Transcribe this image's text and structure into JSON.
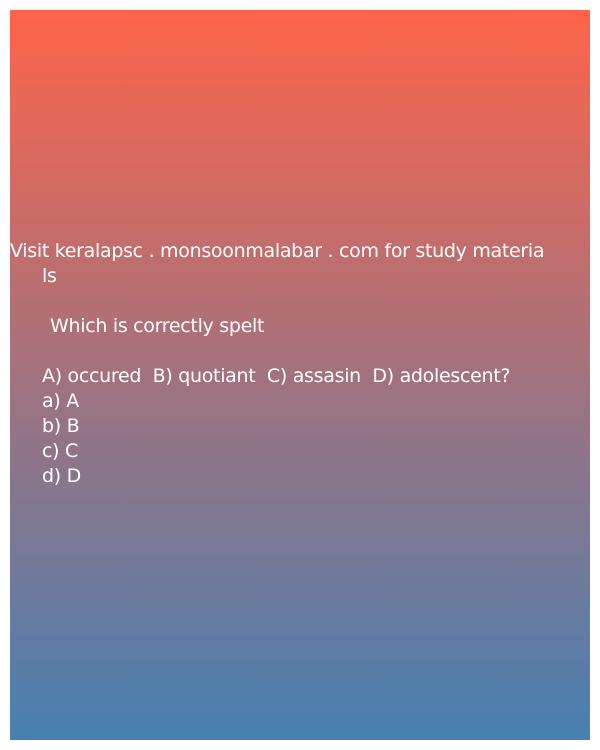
{
  "header": {
    "line1": "Visit keralapsc . monsoonmalabar . com for study materia",
    "line2": "ls"
  },
  "question": {
    "prompt": "Which is correctly spelt",
    "statement": "A) occured  B) quotiant  C) assasin  D) adolescent?"
  },
  "options": [
    {
      "label": "a) A"
    },
    {
      "label": "b) B"
    },
    {
      "label": "c) C"
    },
    {
      "label": "d) D"
    }
  ],
  "colors": {
    "gradient_top": "#fe644a",
    "gradient_bottom": "#4780b2",
    "text": "#ffffff"
  }
}
